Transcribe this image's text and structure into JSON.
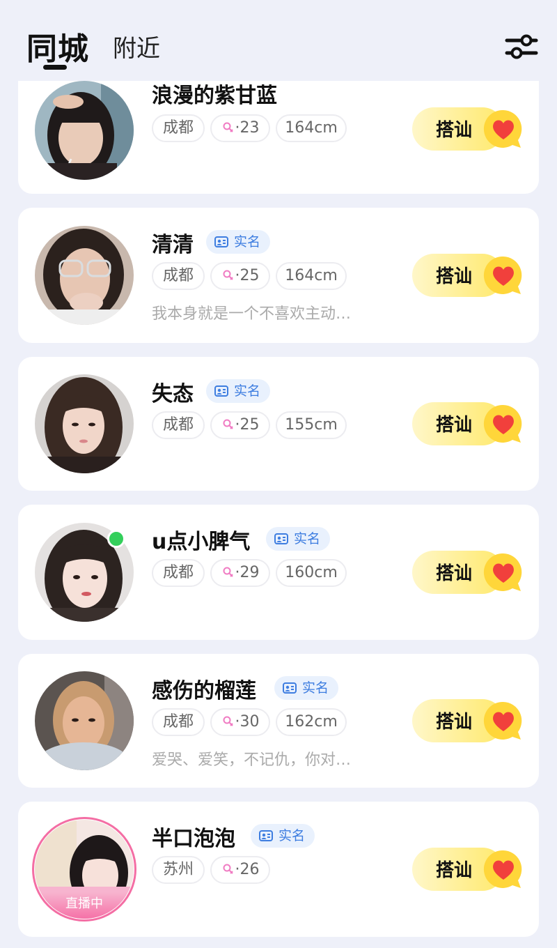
{
  "header": {
    "tab_active": "同城",
    "tab_inactive": "附近",
    "filter_icon": "filter-icon"
  },
  "colors": {
    "background": "#eef0f9",
    "card": "#ffffff",
    "verified_bg": "#e9f1fd",
    "verified_text": "#3d7de0",
    "greet_button": "#ffe96c",
    "online": "#33cf5b",
    "live": "#f46ea4"
  },
  "verified_label": "实名",
  "greet_label": "搭讪",
  "users": [
    {
      "name": "浪漫的紫甘蓝",
      "verified": false,
      "city": "成都",
      "age": "·23",
      "height": "164cm",
      "bio": "",
      "online": false,
      "live": false
    },
    {
      "name": "清清",
      "verified": true,
      "city": "成都",
      "age": "·25",
      "height": "164cm",
      "bio": "我本身就是一个不喜欢主动…",
      "online": false,
      "live": false
    },
    {
      "name": "失态",
      "verified": true,
      "city": "成都",
      "age": "·25",
      "height": "155cm",
      "bio": "",
      "online": false,
      "live": false
    },
    {
      "name": "u点小脾气",
      "verified": true,
      "city": "成都",
      "age": "·29",
      "height": "160cm",
      "bio": "",
      "online": true,
      "live": false
    },
    {
      "name": "感伤的榴莲",
      "verified": true,
      "city": "成都",
      "age": "·30",
      "height": "162cm",
      "bio": "爱哭、爱笑，不记仇，你对…",
      "online": false,
      "live": false
    },
    {
      "name": "半口泡泡",
      "verified": true,
      "city": "苏州",
      "age": "·26",
      "height": "",
      "bio": "",
      "online": false,
      "live": true,
      "live_label": "直播中"
    }
  ]
}
